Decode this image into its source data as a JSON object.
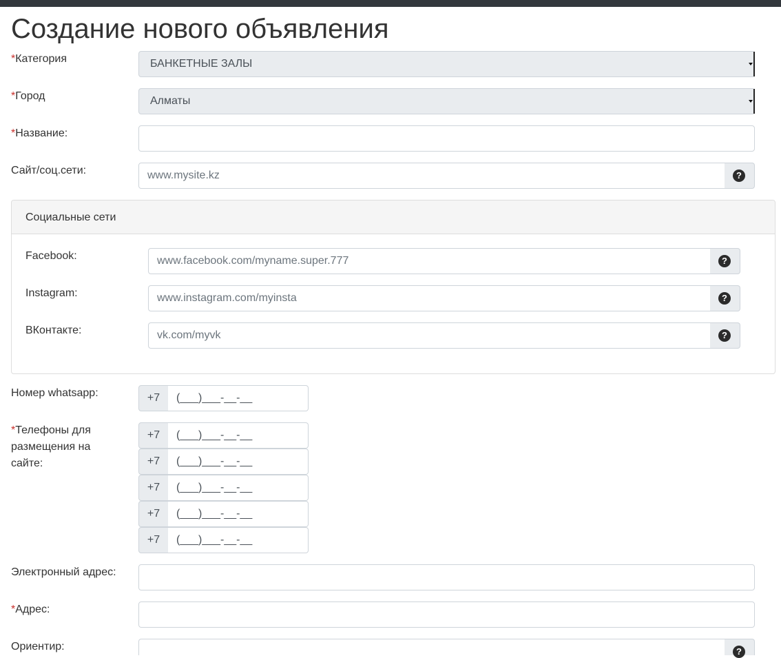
{
  "page": {
    "title": "Создание нового объявления"
  },
  "form": {
    "required_mark": "*",
    "category": {
      "label": "Категория",
      "value": "БАНКЕТНЫЕ ЗАЛЫ"
    },
    "city": {
      "label": "Город",
      "value": "Алматы"
    },
    "name": {
      "label": "Название:",
      "value": ""
    },
    "website": {
      "label": "Сайт/соц.сети:",
      "placeholder": "www.mysite.kz",
      "help_icon": "question-circle-icon"
    },
    "social": {
      "heading": "Социальные сети",
      "facebook": {
        "label": "Facebook:",
        "placeholder": "www.facebook.com/myname.super.777"
      },
      "instagram": {
        "label": "Instagram:",
        "placeholder": "www.instagram.com/myinsta"
      },
      "vk": {
        "label": "ВКонтакте:",
        "placeholder": "vk.com/myvk"
      }
    },
    "whatsapp": {
      "label": "Номер whatsapp:",
      "prefix": "+7",
      "placeholder": "(___)___-__-__"
    },
    "phones": {
      "label": "Телефоны для размещения на сайте:",
      "prefix": "+7",
      "placeholder": "(___)___-__-__",
      "count": 5
    },
    "email": {
      "label": "Электронный адрес:",
      "value": ""
    },
    "address": {
      "label": "Адрес:",
      "value": ""
    },
    "landmark": {
      "label": "Ориентир:",
      "value": ""
    }
  },
  "colors": {
    "top_bar": "#33383d",
    "required": "#c9302c",
    "addon_bg": "#e9ecef",
    "border": "#ced4da"
  }
}
